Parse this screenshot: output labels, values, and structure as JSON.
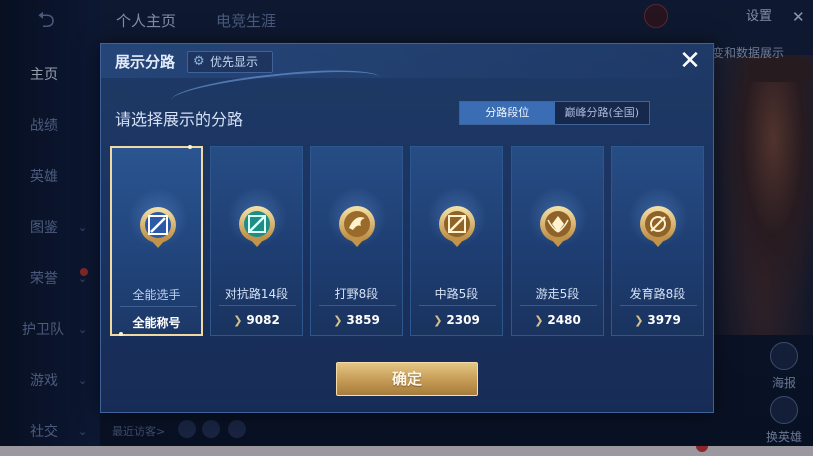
{
  "background": {
    "back_glyph": "⮌",
    "top_tabs": [
      "个人主页",
      "电竞生涯"
    ],
    "nav": [
      {
        "label": "主页",
        "active": true,
        "chevron": false,
        "dot": false
      },
      {
        "label": "战绩",
        "active": false,
        "chevron": false,
        "dot": false
      },
      {
        "label": "英雄",
        "active": false,
        "chevron": false,
        "dot": false
      },
      {
        "label": "图鉴",
        "active": false,
        "chevron": true,
        "dot": false
      },
      {
        "label": "荣誉",
        "active": false,
        "chevron": true,
        "dot": true
      },
      {
        "label": "护卫队",
        "active": false,
        "chevron": true,
        "dot": false
      },
      {
        "label": "游戏",
        "active": false,
        "chevron": true,
        "dot": false
      },
      {
        "label": "社交",
        "active": false,
        "chevron": true,
        "dot": false
      }
    ],
    "settings_label": "设置",
    "close_glyph": "✕",
    "data_display_label": "变和数据展示",
    "side_buttons": [
      {
        "label": "海报"
      },
      {
        "label": "换英雄"
      }
    ],
    "recent_visitors_label": "最近访客>"
  },
  "modal": {
    "title": "展示分路",
    "priority_label": "优先显示",
    "close_glyph": "✕",
    "subtitle": "请选择展示的分路",
    "toggle": {
      "options": [
        "分路段位",
        "巅峰分路(全国)"
      ],
      "active_index": 0
    },
    "cards": [
      {
        "label": "全能选手",
        "score": "全能称号",
        "icon": "all-round-emblem-icon",
        "selected": true,
        "has_chevron": false
      },
      {
        "label": "对抗路14段",
        "score": "9082",
        "icon": "clash-lane-emblem-icon",
        "selected": false,
        "has_chevron": true
      },
      {
        "label": "打野8段",
        "score": "3859",
        "icon": "jungle-emblem-icon",
        "selected": false,
        "has_chevron": true
      },
      {
        "label": "中路5段",
        "score": "2309",
        "icon": "mid-lane-emblem-icon",
        "selected": false,
        "has_chevron": true
      },
      {
        "label": "游走5段",
        "score": "2480",
        "icon": "roam-emblem-icon",
        "selected": false,
        "has_chevron": true
      },
      {
        "label": "发育路8段",
        "score": "3979",
        "icon": "farm-lane-emblem-icon",
        "selected": false,
        "has_chevron": true
      }
    ],
    "score_glyph": "❯",
    "confirm_label": "确定"
  },
  "colors": {
    "accent_gold": "#d8b570",
    "selected_border": "#f1d9a4",
    "toggle_active": "#3a6db4"
  }
}
